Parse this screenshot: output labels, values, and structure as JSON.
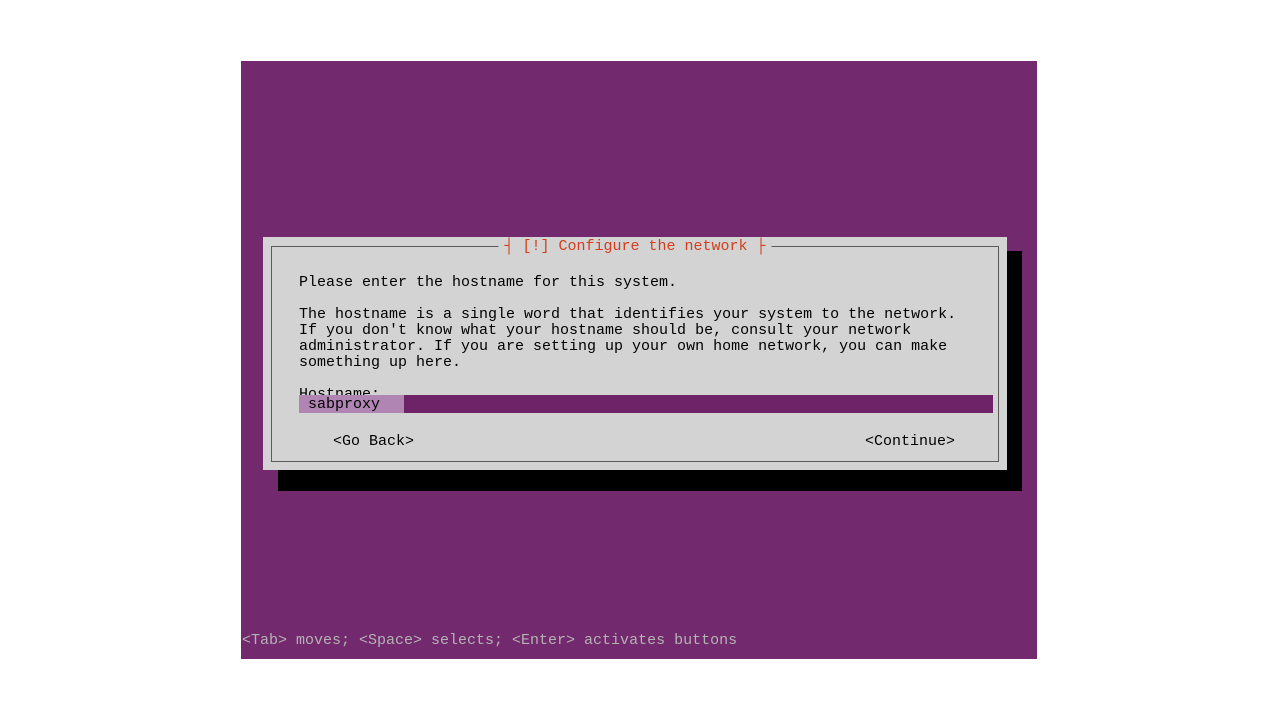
{
  "dialog": {
    "title": "┤ [!] Configure the network ├",
    "prompt": "Please enter the hostname for this system.",
    "description": "The hostname is a single word that identifies your system to the network. If you don't know what your hostname should be, consult your network administrator. If you are setting up your own home network, you can make something up here.",
    "field_label": "Hostname:",
    "input_value": "sabproxy",
    "nav": {
      "back": "<Go Back>",
      "continue": "<Continue>"
    }
  },
  "hints": "<Tab> moves; <Space> selects; <Enter> activates buttons"
}
